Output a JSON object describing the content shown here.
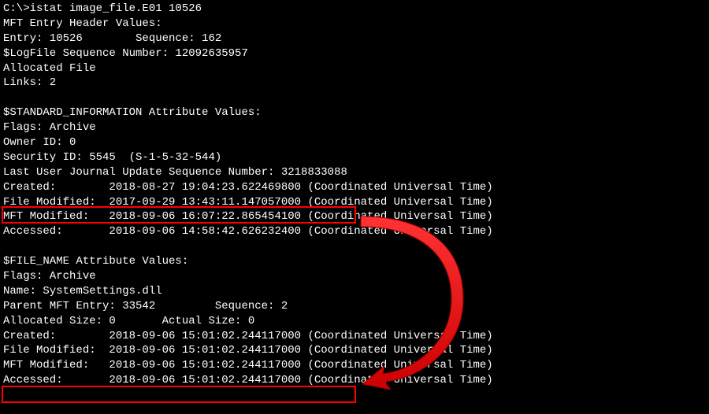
{
  "prompt": "C:\\>istat image_file.E01 10526",
  "header": {
    "title": "MFT Entry Header Values:",
    "entry_line": "Entry: 10526        Sequence: 162",
    "logfile": "$LogFile Sequence Number: 12092635957",
    "allocated": "Allocated File",
    "links": "Links: 2"
  },
  "std_info": {
    "title": "$STANDARD_INFORMATION Attribute Values:",
    "flags": "Flags: Archive",
    "owner": "Owner ID: 0",
    "security": "Security ID: 5545  (S-1-5-32-544)",
    "journal": "Last User Journal Update Sequence Number: 3218833088",
    "created": "Created:        2018-08-27 19:04:23.622469800 (Coordinated Universal Time)",
    "file_modified": "File Modified:  2017-09-29 13:43:11.147057000 (Coordinated Universal Time)",
    "mft_modified": "MFT Modified:   2018-09-06 16:07:22.865454100 (Coordinated Universal Time)",
    "accessed": "Accessed:       2018-09-06 14:58:42.626232400 (Coordinated Universal Time)"
  },
  "file_name": {
    "title": "$FILE_NAME Attribute Values:",
    "flags": "Flags: Archive",
    "name": "Name: SystemSettings.dll",
    "parent": "Parent MFT Entry: 33542         Sequence: 2",
    "sizes": "Allocated Size: 0       Actual Size: 0",
    "created": "Created:        2018-09-06 15:01:02.244117000 (Coordinated Universal Time)",
    "file_modified": "File Modified:  2018-09-06 15:01:02.244117000 (Coordinated Universal Time)",
    "mft_modified": "MFT Modified:   2018-09-06 15:01:02.244117000 (Coordinated Universal Time)",
    "accessed": "Accessed:       2018-09-06 15:01:02.244117000 (Coordinated Universal Time)"
  }
}
